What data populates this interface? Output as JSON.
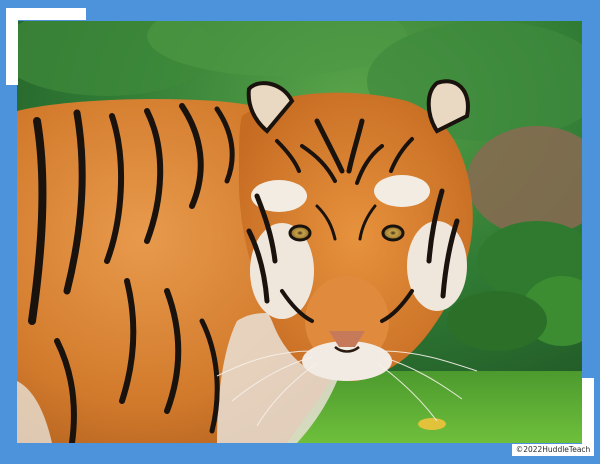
{
  "image": {
    "subject": "tiger",
    "frame_color": "#4d93dc",
    "corner_color": "#ffffff"
  },
  "watermark": {
    "text": "©2022HuddleTeach"
  }
}
